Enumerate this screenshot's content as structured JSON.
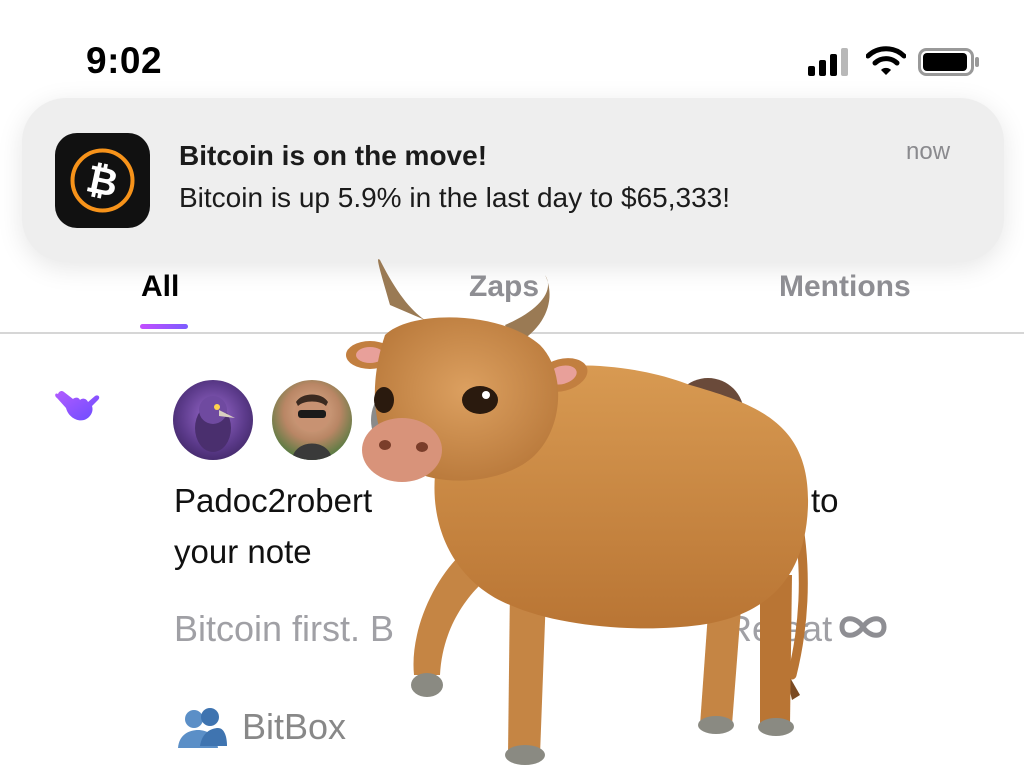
{
  "status_bar": {
    "time": "9:02",
    "signal_icon": "cellular-signal-icon",
    "wifi_icon": "wifi-icon",
    "battery_icon": "battery-icon"
  },
  "notification": {
    "app_icon": "bitcoin-icon",
    "title": "Bitcoin is on the move!",
    "body": "Bitcoin is up 5.9% in the last day to $65,333!",
    "time": "now"
  },
  "tabs": {
    "all": "All",
    "zaps": "Zaps",
    "mentions": "Mentions",
    "selected": "All"
  },
  "activity": {
    "reaction_icon": "shaka-hand-icon",
    "message_start": "Padoc2robert",
    "message_end": "to",
    "message_line2": "your note",
    "note_excerpt": "Bitcoin first. B",
    "note_excerpt_tail": "Re  eat",
    "note_emoji": "infinity-icon",
    "community_icon": "group-icon",
    "community_name": "BitBox"
  },
  "overlay": {
    "sticker": "bull-emoji"
  },
  "colors": {
    "accent_gradient_start": "#c44dff",
    "accent_gradient_end": "#7b5cff",
    "bitcoin_orange": "#f7931a",
    "muted_text": "#8e8e93"
  }
}
